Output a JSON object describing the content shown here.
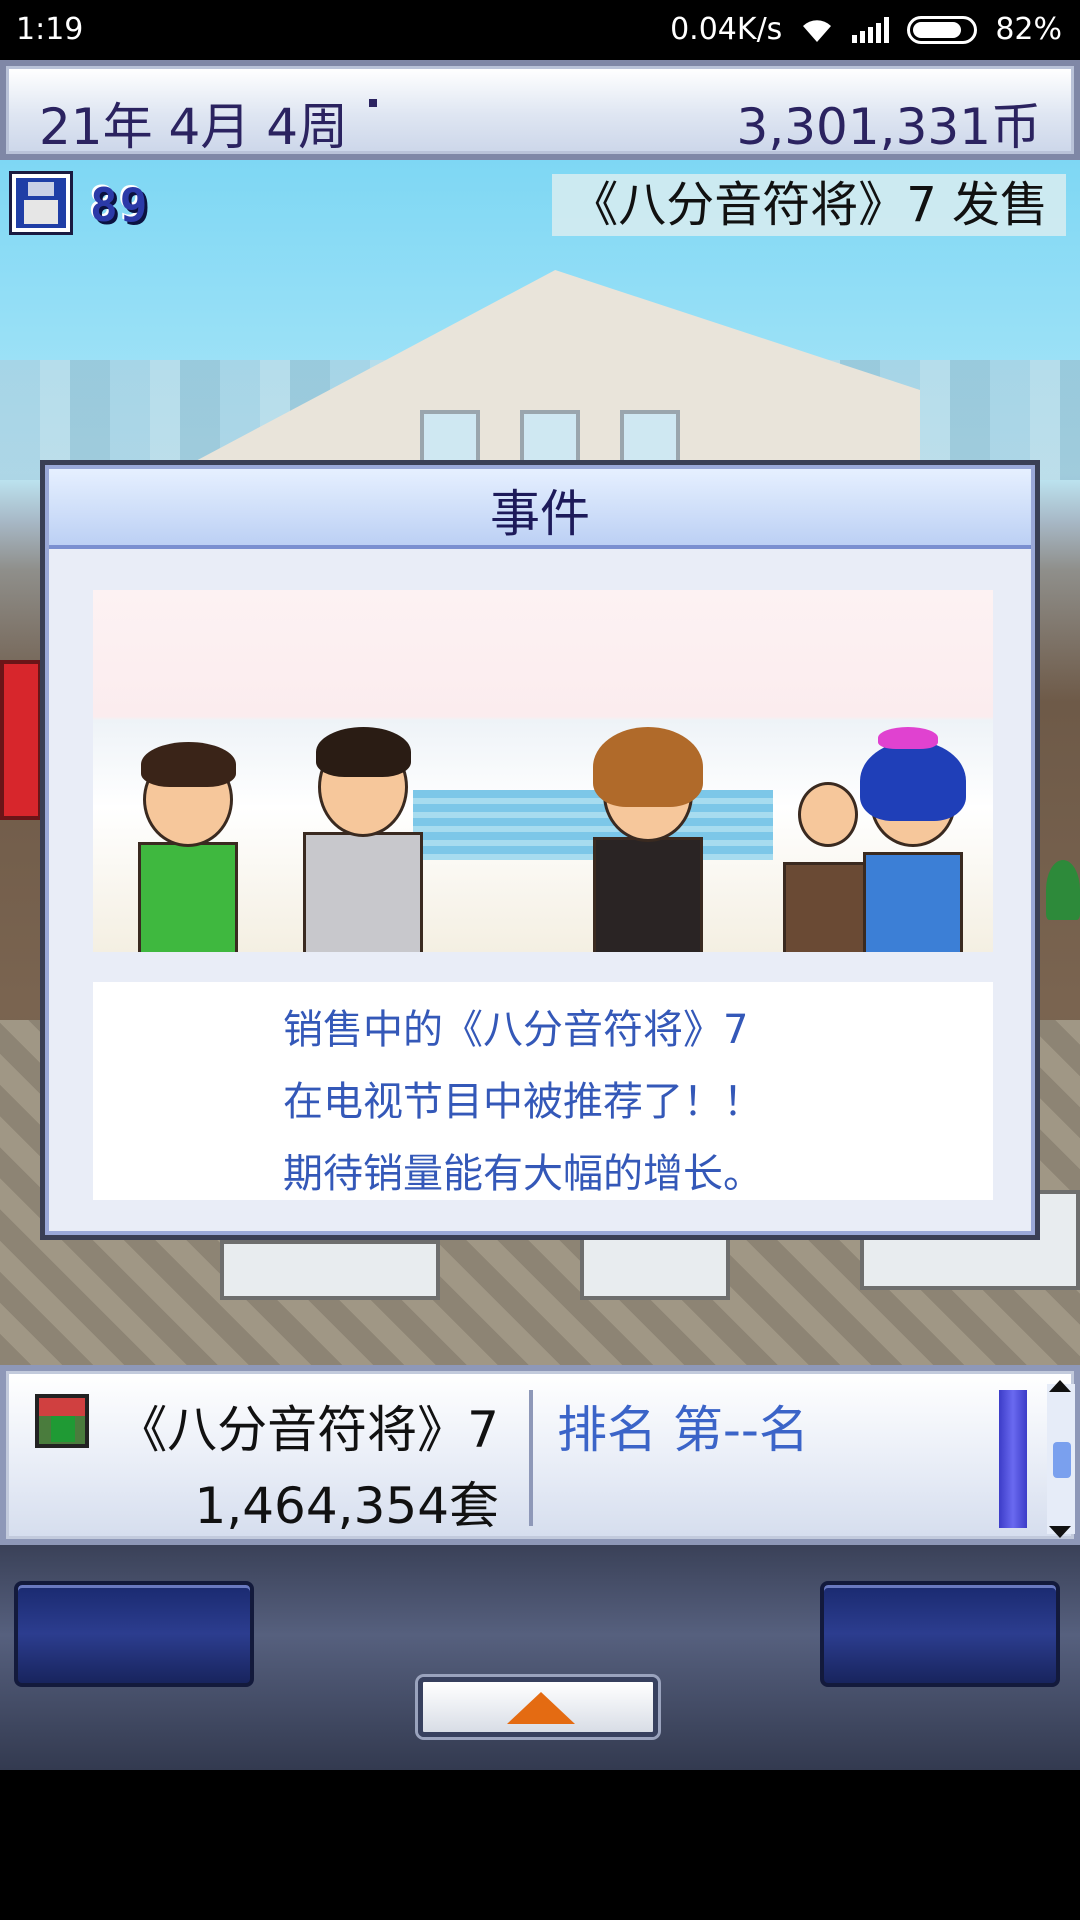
{
  "status_bar": {
    "time": "1:19",
    "network_speed": "0.04K/s",
    "battery": "82%"
  },
  "top_bar": {
    "date": "21年 4月 4周",
    "money": "3,301,331币"
  },
  "hud": {
    "points": "89",
    "release_banner": "《八分音符将》7 发售"
  },
  "event_dialog": {
    "title": "事件",
    "lines": [
      "销售中的《八分音符将》7",
      "在电视节目中被推荐了！！",
      "期待销量能有大幅的增长。"
    ]
  },
  "info_panel": {
    "game_name": "《八分音符将》7",
    "sales": "1,464,354套",
    "rank": "排名 第--名"
  },
  "colors": {
    "accent_text": "#3458b8",
    "title_text": "#1d1a5a",
    "arrow": "#e46b12"
  }
}
